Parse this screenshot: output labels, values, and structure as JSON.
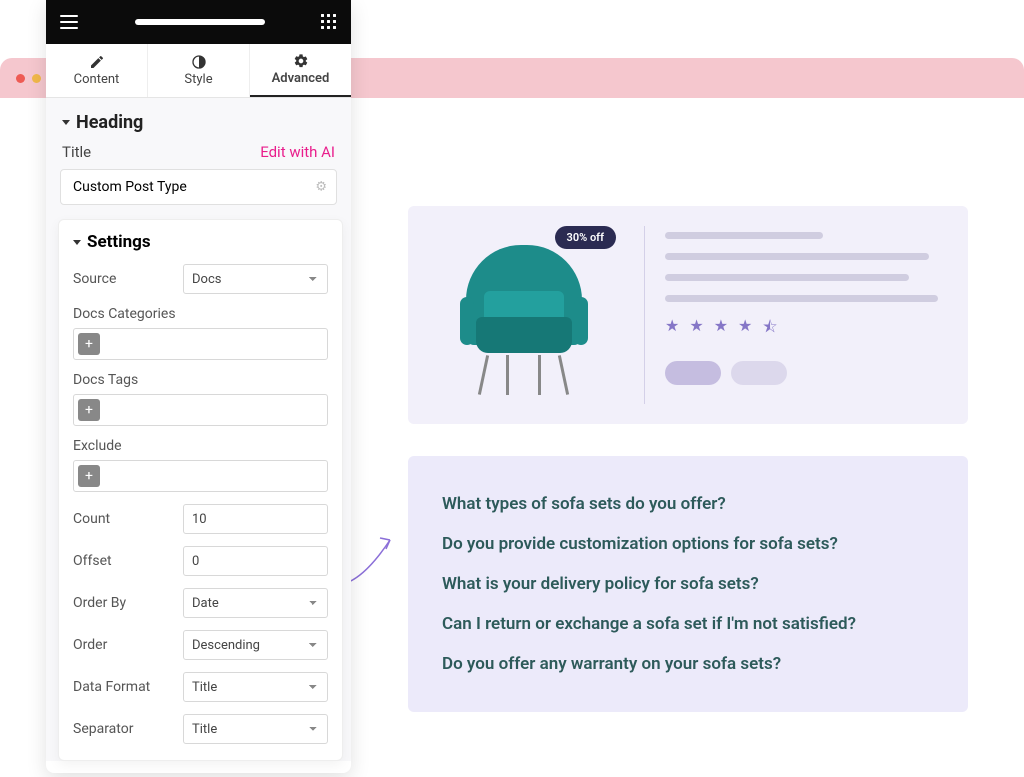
{
  "editor": {
    "tabs": {
      "content": "Content",
      "style": "Style",
      "advanced": "Advanced"
    },
    "heading_section": "Heading",
    "title_label": "Title",
    "edit_ai": "Edit with AI",
    "title_value": "Custom Post Type",
    "settings_section": "Settings",
    "controls": {
      "source_label": "Source",
      "source_value": "Docs",
      "docs_categories_label": "Docs Categories",
      "docs_tags_label": "Docs Tags",
      "exclude_label": "Exclude",
      "count_label": "Count",
      "count_value": "10",
      "offset_label": "Offset",
      "offset_value": "0",
      "order_by_label": "Order By",
      "order_by_value": "Date",
      "order_label": "Order",
      "order_value": "Descending",
      "data_format_label": "Data Format",
      "data_format_value": "Title",
      "separator_label": "Separator",
      "separator_value": "Title"
    }
  },
  "product": {
    "badge": "30% off"
  },
  "faq": {
    "items": [
      "What types of sofa sets do you offer?",
      "Do you provide customization options for sofa sets?",
      "What is your delivery policy for sofa sets?",
      "Can I return or exchange a sofa set if I'm not satisfied?",
      "Do you offer any warranty on your sofa sets?"
    ]
  }
}
